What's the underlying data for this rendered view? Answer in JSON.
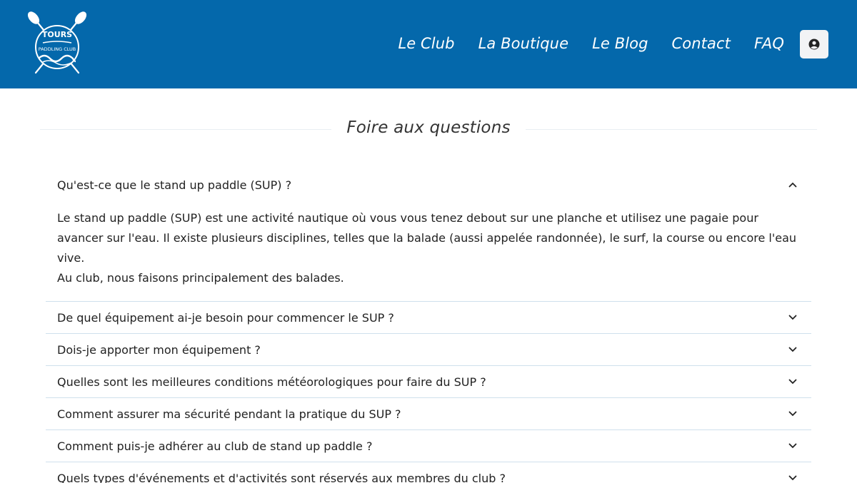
{
  "brand": {
    "logo_text_top": "TOURS",
    "logo_text_bottom": "PADDLING CLUB",
    "header_color": "#0468ab"
  },
  "nav": {
    "items": [
      {
        "label": "Le Club"
      },
      {
        "label": "La Boutique"
      },
      {
        "label": "Le Blog"
      },
      {
        "label": "Contact"
      },
      {
        "label": "FAQ"
      }
    ],
    "account_icon": "user-circle-icon"
  },
  "page": {
    "title": "Foire aux questions"
  },
  "faq": {
    "items": [
      {
        "question": "Qu'est-ce que le stand up paddle (SUP) ?",
        "expanded": true,
        "answer_lines": [
          "Le stand up paddle (SUP) est une activité nautique où vous vous tenez debout sur une planche et utilisez une pagaie pour avancer sur l'eau. Il existe plusieurs disciplines, telles que la balade (aussi appelée randonnée), le surf, la course ou encore l'eau vive.",
          "Au club, nous faisons principalement des balades."
        ]
      },
      {
        "question": "De quel équipement ai-je besoin pour commencer le SUP ?",
        "expanded": false
      },
      {
        "question": "Dois-je apporter mon équipement ?",
        "expanded": false
      },
      {
        "question": "Quelles sont les meilleures conditions météorologiques pour faire du SUP ?",
        "expanded": false
      },
      {
        "question": "Comment assurer ma sécurité pendant la pratique du SUP ?",
        "expanded": false
      },
      {
        "question": "Comment puis-je adhérer au club de stand up paddle ?",
        "expanded": false
      },
      {
        "question": "Quels types d'événements et d'activités sont réservés aux membres du club ?",
        "expanded": false
      }
    ]
  }
}
